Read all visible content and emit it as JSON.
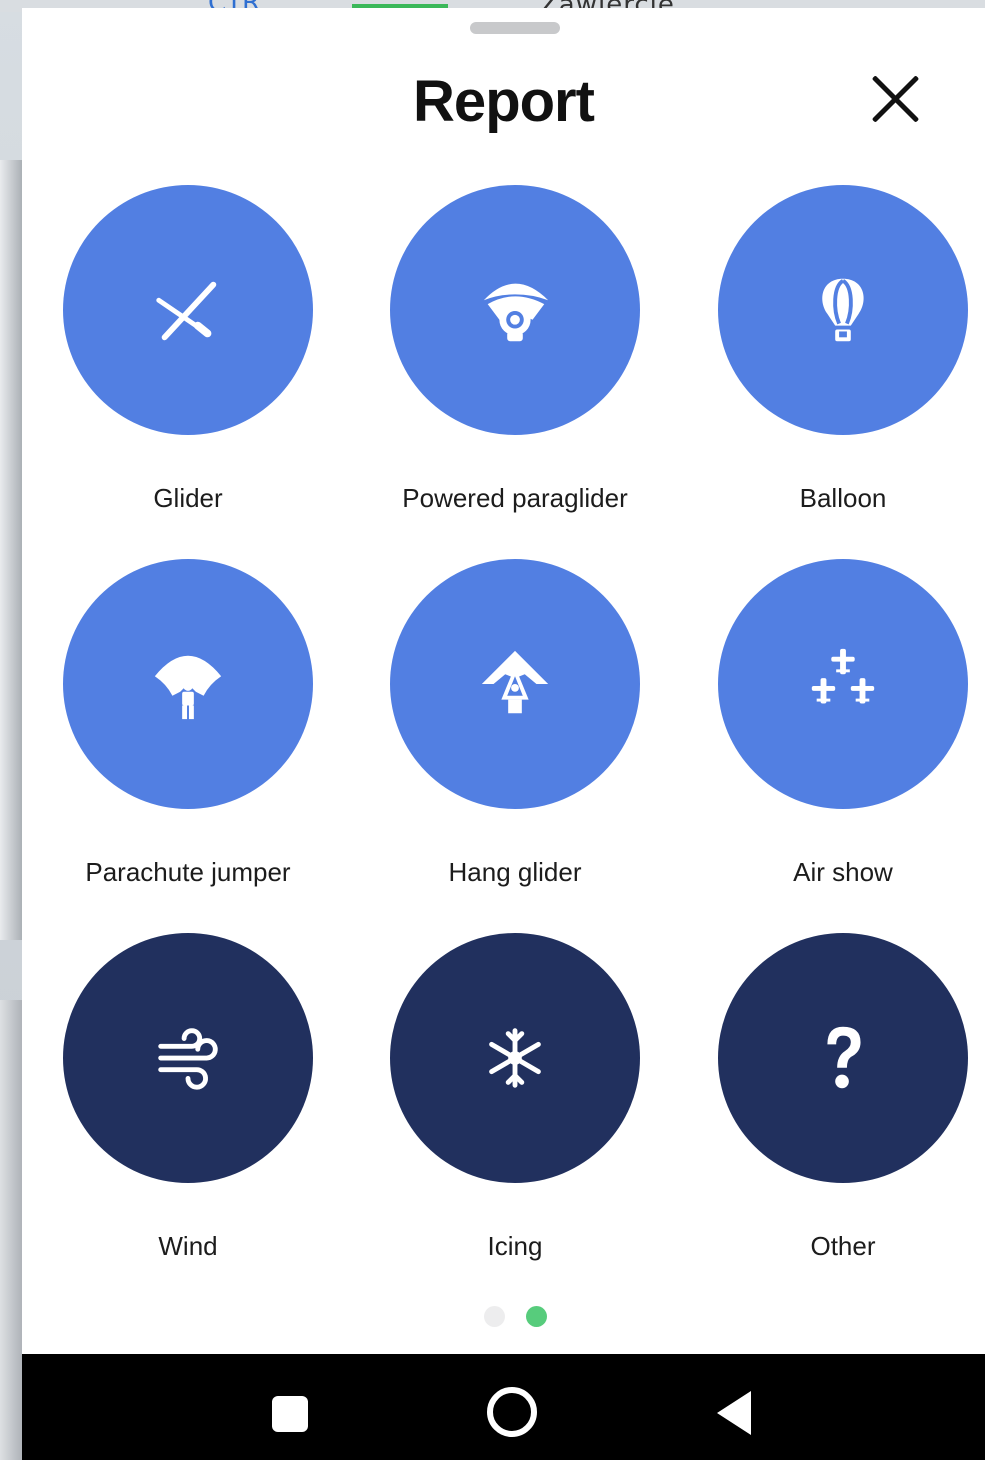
{
  "map": {
    "top_text": "Zawiercie",
    "top_blue_text": "CTR"
  },
  "sheet": {
    "title": "Report",
    "close_icon": "close-icon",
    "items": [
      {
        "label": "Glider",
        "icon": "glider-icon",
        "color": "#527fe2"
      },
      {
        "label": "Powered paraglider",
        "icon": "powered-paraglider-icon",
        "color": "#527fe2"
      },
      {
        "label": "Balloon",
        "icon": "balloon-icon",
        "color": "#527fe2"
      },
      {
        "label": "Parachute jumper",
        "icon": "parachute-jumper-icon",
        "color": "#527fe2"
      },
      {
        "label": "Hang glider",
        "icon": "hang-glider-icon",
        "color": "#527fe2"
      },
      {
        "label": "Air show",
        "icon": "air-show-icon",
        "color": "#527fe2"
      },
      {
        "label": "Wind",
        "icon": "wind-icon",
        "color": "#21305e"
      },
      {
        "label": "Icing",
        "icon": "icing-icon",
        "color": "#21305e"
      },
      {
        "label": "Other",
        "icon": "question-mark-icon",
        "color": "#21305e"
      }
    ],
    "pager": {
      "total": 2,
      "active_index": 1,
      "active_color": "#57cc7c"
    }
  },
  "navbar": {
    "recents": "square-icon",
    "home": "home-circle-icon",
    "back": "back-triangle-icon"
  }
}
